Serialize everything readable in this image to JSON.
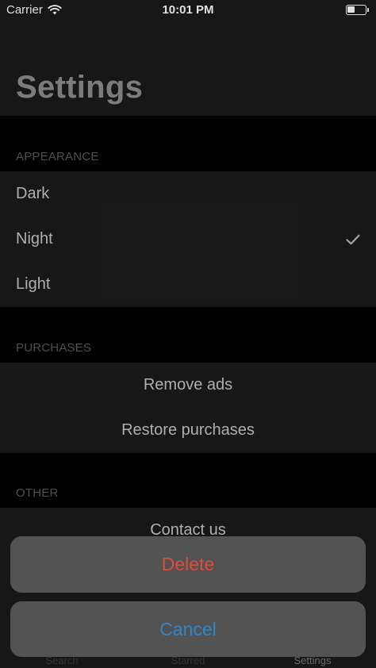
{
  "status_bar": {
    "carrier": "Carrier",
    "time": "10:01 PM"
  },
  "nav": {
    "title": "Settings"
  },
  "sections": {
    "appearance": {
      "header": "APPEARANCE",
      "items": [
        {
          "label": "Dark",
          "selected": false
        },
        {
          "label": "Night",
          "selected": true
        },
        {
          "label": "Light",
          "selected": false
        }
      ]
    },
    "purchases": {
      "header": "PURCHASES",
      "items": [
        {
          "label": "Remove ads"
        },
        {
          "label": "Restore purchases"
        }
      ]
    },
    "other": {
      "header": "OTHER",
      "items": [
        {
          "label": "Contact us"
        }
      ]
    }
  },
  "tab_bar": {
    "tabs": [
      {
        "label": "Search",
        "active": false
      },
      {
        "label": "Starred",
        "active": false
      },
      {
        "label": "Settings",
        "active": true
      }
    ]
  },
  "action_sheet": {
    "delete_label": "Delete",
    "cancel_label": "Cancel"
  },
  "colors": {
    "background": "#000000",
    "surface": "#1b1b1b",
    "text": "#c7c7c7",
    "sheet": "#535353",
    "destructive": "#e04a3f",
    "accent": "#2f86c7"
  },
  "icons": [
    "wifi-icon",
    "battery-icon",
    "checkmark-icon"
  ]
}
